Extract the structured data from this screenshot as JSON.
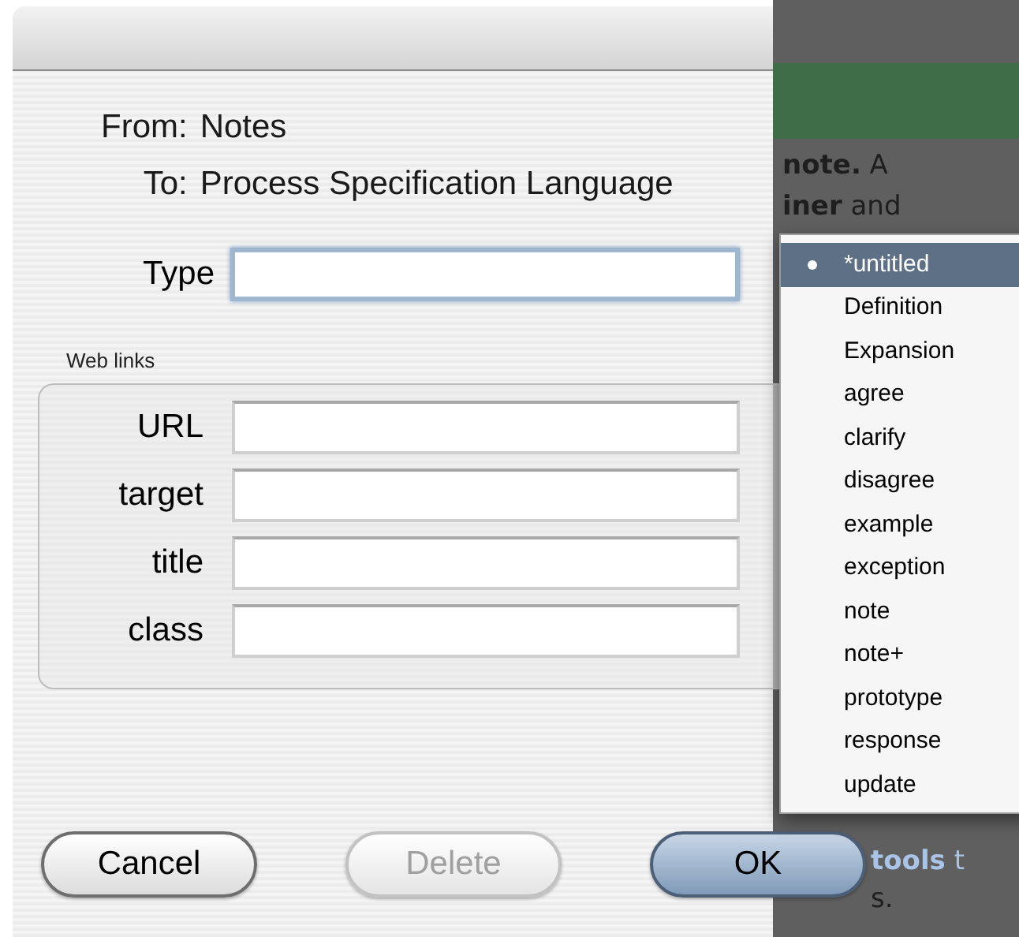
{
  "background": {
    "lines": [
      {
        "text": "**note.** A",
        "kind": "dim"
      },
      {
        "text": "**iner** and",
        "kind": "dim"
      },
      {
        "text": "**tools** t",
        "kind": "link"
      },
      {
        "text": "s.",
        "kind": "dim"
      }
    ]
  },
  "dialog": {
    "from_label": "From:",
    "from_value": "Notes",
    "to_label": "To:",
    "to_value": "Process Specification Language",
    "type_field": {
      "label": "Type",
      "focused": true
    },
    "web_links": {
      "title": "Web links",
      "fields": [
        {
          "label": "URL",
          "focused": false
        },
        {
          "label": "target",
          "focused": false
        },
        {
          "label": "title",
          "focused": false
        },
        {
          "label": "class",
          "focused": false
        }
      ]
    },
    "buttons": [
      {
        "label": "Cancel",
        "disabled": false,
        "default": false
      },
      {
        "label": "Delete",
        "disabled": true,
        "default": false
      },
      {
        "label": "OK",
        "disabled": false,
        "default": true
      }
    ]
  },
  "menu": {
    "items": [
      {
        "label": "*untitled",
        "selected": true,
        "checked": true
      },
      {
        "label": "Definition",
        "selected": false,
        "checked": false
      },
      {
        "label": "Expansion",
        "selected": false,
        "checked": false
      },
      {
        "label": "agree",
        "selected": false,
        "checked": false
      },
      {
        "label": "clarify",
        "selected": false,
        "checked": false
      },
      {
        "label": "disagree",
        "selected": false,
        "checked": false
      },
      {
        "label": "example",
        "selected": false,
        "checked": false
      },
      {
        "label": "exception",
        "selected": false,
        "checked": false
      },
      {
        "label": "note",
        "selected": false,
        "checked": false
      },
      {
        "label": "note+",
        "selected": false,
        "checked": false
      },
      {
        "label": "prototype",
        "selected": false,
        "checked": false
      },
      {
        "label": "response",
        "selected": false,
        "checked": false
      },
      {
        "label": "update",
        "selected": false,
        "checked": false
      }
    ]
  }
}
